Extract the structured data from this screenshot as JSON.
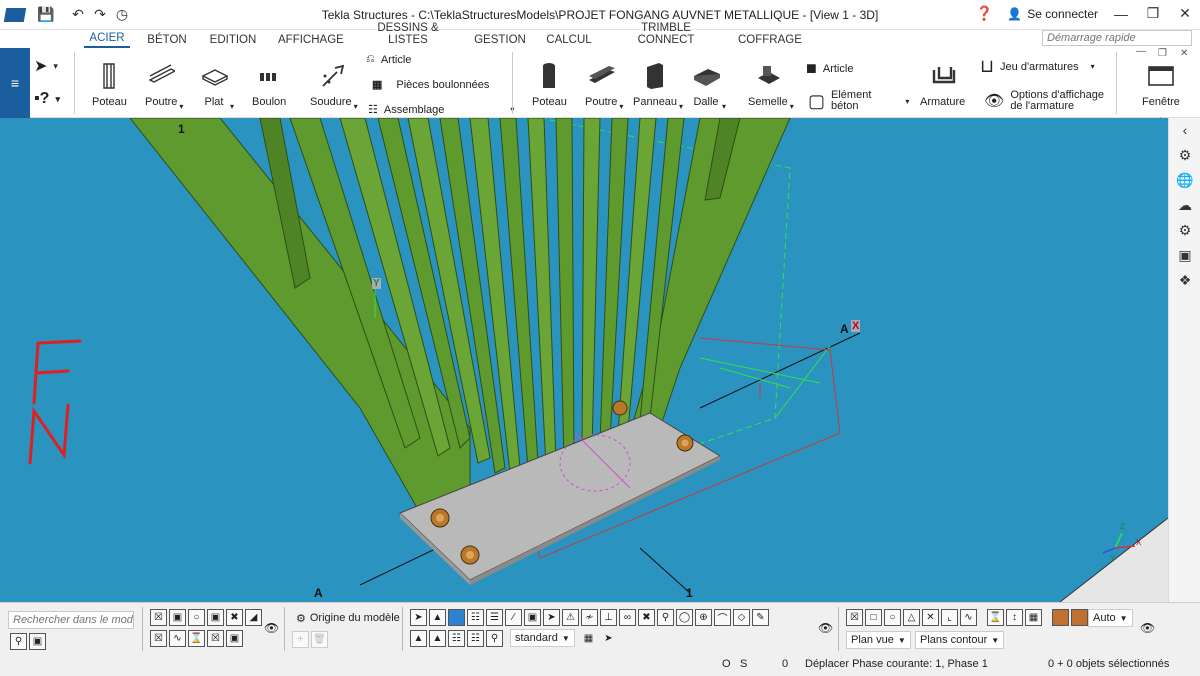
{
  "window": {
    "title": "Tekla Structures - C:\\TeklaStructuresModels\\PROJET FONGANG AUVNET METALLIQUE  - [View 1 - 3D]",
    "signin": "Se connecter"
  },
  "tabs": [
    "ACIER",
    "BÉTON",
    "EDITION",
    "AFFICHAGE",
    "DESSINS & LISTES",
    "GESTION",
    "CALCUL",
    "TRIMBLE CONNECT",
    "COFFRAGE"
  ],
  "quick_search": {
    "placeholder": "Démarrage rapide"
  },
  "ribbon": {
    "steel": {
      "poteau": "Poteau",
      "poutre": "Poutre",
      "plat": "Plat",
      "boulon": "Boulon",
      "soudure": "Soudure",
      "article": "Article",
      "pieces_boulonnees": "Pièces boulonnées",
      "assemblage": "Assemblage"
    },
    "concrete": {
      "poteau": "Poteau",
      "poutre": "Poutre",
      "panneau": "Panneau",
      "dalle": "Dalle",
      "semelle": "Semelle",
      "article": "Article",
      "element_beton_1": "Elément",
      "element_beton_2": "béton",
      "armature": "Armature",
      "jeu_armatures": "Jeu d'armatures",
      "options_affichage_1": "Options d'affichage",
      "options_affichage_2": "de l'armature",
      "fenetre": "Fenêtre"
    }
  },
  "viewport": {
    "grid_labels": {
      "top": "1",
      "bottom_left": "A",
      "bottom_right": "1",
      "axis_a": "A"
    },
    "axes": {
      "x": "X",
      "y": "Y",
      "z": "Z"
    },
    "handwriting": "FN",
    "colors": {
      "background": "#2b93c0",
      "steel": "#5f9a2e",
      "plate": "#b9b9b9",
      "bolt": "#b8792a"
    }
  },
  "bottom": {
    "search_placeholder": "Rechercher dans le mod",
    "origin_label": "Origine du modèle",
    "standard": "standard",
    "auto": "Auto",
    "plan_vue": "Plan vue",
    "plans_contour": "Plans contour"
  },
  "status": {
    "o": "O",
    "s": "S",
    "count": "0",
    "message": "Déplacer Phase courante: 1, Phase 1",
    "selection": "0 + 0 objets sélectionnés"
  }
}
